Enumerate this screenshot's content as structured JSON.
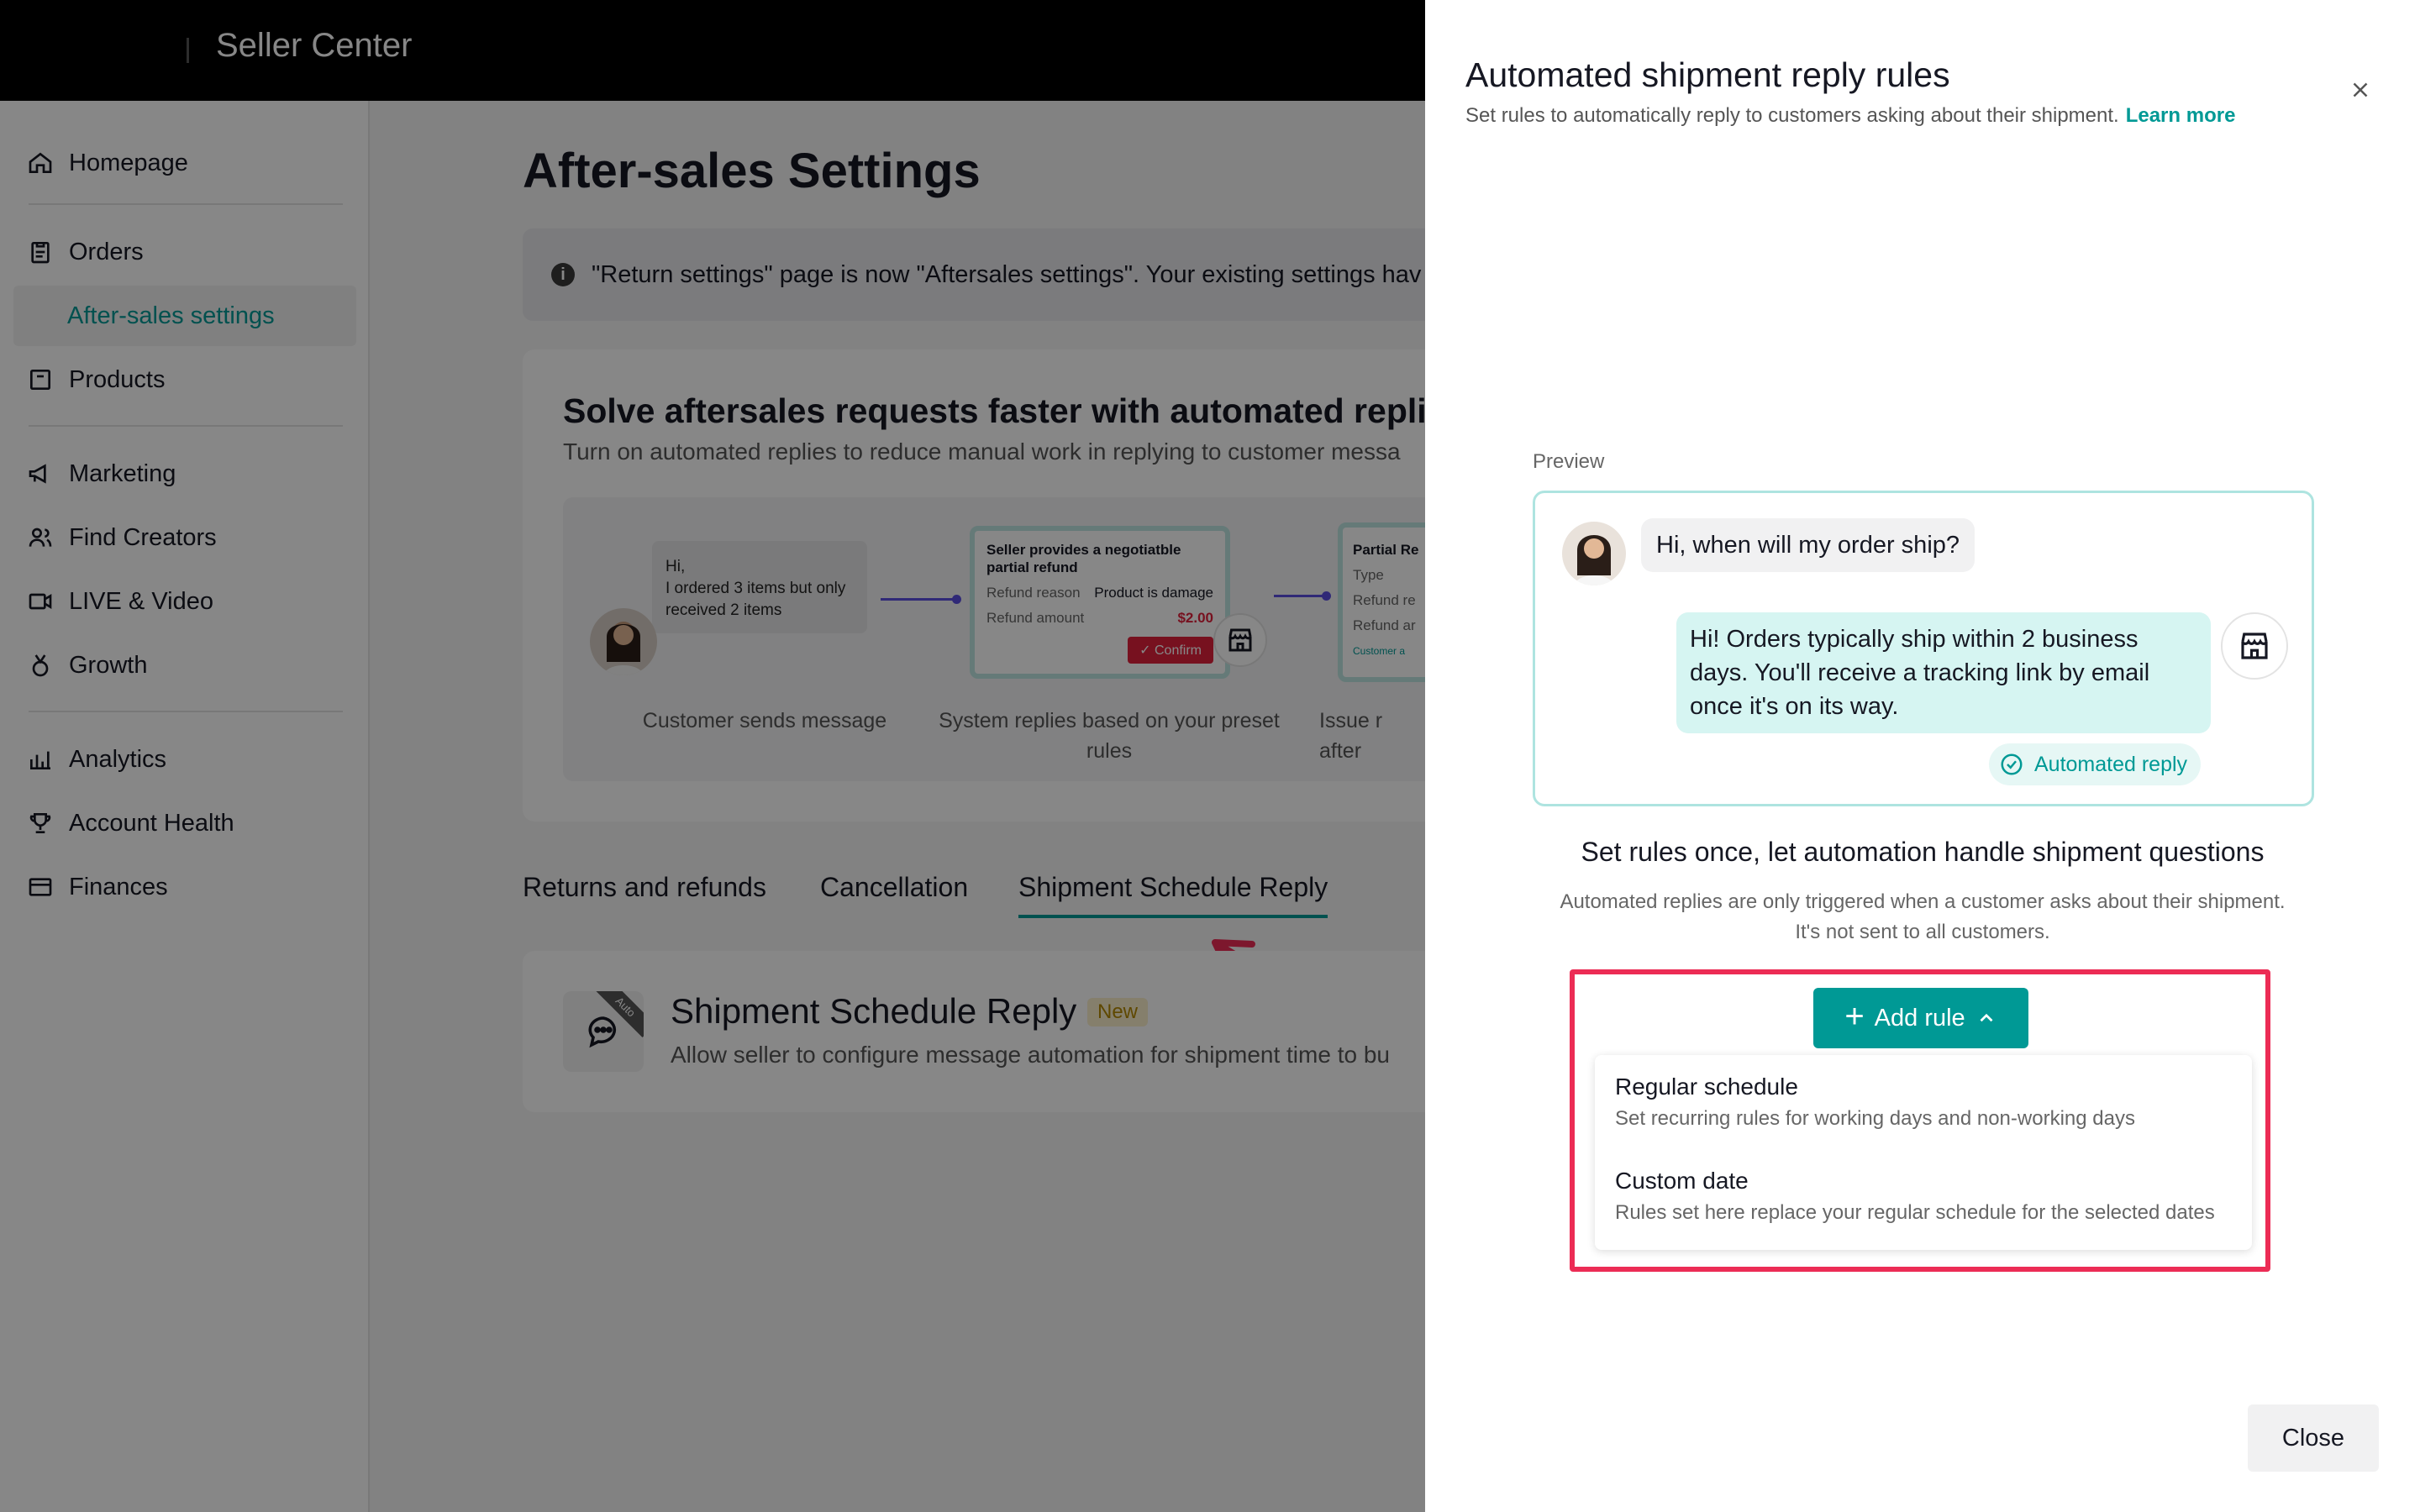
{
  "header": {
    "brand": "Seller Center"
  },
  "sidebar": {
    "items": [
      {
        "label": "Homepage",
        "icon": "home-icon"
      },
      {
        "label": "Orders",
        "icon": "clipboard-icon"
      },
      {
        "label": "After-sales settings",
        "icon": ""
      },
      {
        "label": "Products",
        "icon": "box-icon"
      },
      {
        "label": "Marketing",
        "icon": "megaphone-icon"
      },
      {
        "label": "Find Creators",
        "icon": "users-icon"
      },
      {
        "label": "LIVE & Video",
        "icon": "video-icon"
      },
      {
        "label": "Growth",
        "icon": "medal-icon"
      },
      {
        "label": "Analytics",
        "icon": "bar-chart-icon"
      },
      {
        "label": "Account Health",
        "icon": "trophy-icon"
      },
      {
        "label": "Finances",
        "icon": "wallet-icon"
      }
    ]
  },
  "main": {
    "title": "After-sales Settings",
    "notice": "\"Return settings\" page is now \"Aftersales settings\". Your existing settings hav",
    "promo": {
      "title": "Solve aftersales requests faster with automated replies",
      "subtitle": "Turn on automated replies to reduce manual work in replying to customer messa",
      "bubble": "Hi,\nI ordered 3 items but only received 2 items",
      "mini_card": {
        "heading": "Seller provides a negotiatble partial refund",
        "reason_label": "Refund reason",
        "reason_value": "Product is damage",
        "amount_label": "Refund amount",
        "amount_value": "$2.00",
        "confirm": "Confirm"
      },
      "mini_card2": {
        "heading": "Partial Re",
        "type": "Type",
        "refund_re": "Refund re",
        "refund_ar": "Refund ar",
        "customer": "Customer a"
      },
      "captions": [
        "Customer sends message",
        "System replies based on your preset rules",
        "Issue r after"
      ]
    },
    "tabs": [
      "Returns and refunds",
      "Cancellation",
      "Shipment Schedule Reply"
    ],
    "active_tab": "Shipment Schedule Reply",
    "ssr": {
      "ribbon": "Auto",
      "title": "Shipment Schedule Reply",
      "badge": "New",
      "description": "Allow seller to configure message automation for shipment time to bu"
    }
  },
  "drawer": {
    "title": "Automated shipment reply rules",
    "subtitle": "Set rules to automatically reply to customers asking about their shipment.",
    "learn_more": "Learn more",
    "preview_label": "Preview",
    "customer_message": "Hi, when will my order ship?",
    "auto_message": "Hi! Orders typically ship within 2 business days. You'll receive a tracking link by email once it's on its way.",
    "auto_label": "Automated reply",
    "headline": "Set rules once, let automation handle shipment questions",
    "explain_1": "Automated replies are only triggered when a customer asks about their shipment.",
    "explain_2": "It's not sent to all customers.",
    "add_rule": "Add rule",
    "menu": [
      {
        "title": "Regular schedule",
        "desc": "Set recurring rules for working days and non-working days"
      },
      {
        "title": "Custom date",
        "desc": "Rules set here replace your regular schedule for the selected dates"
      }
    ],
    "close": "Close"
  },
  "colors": {
    "accent": "#009995",
    "highlight": "#ec2c55",
    "topbar": "#000000"
  }
}
